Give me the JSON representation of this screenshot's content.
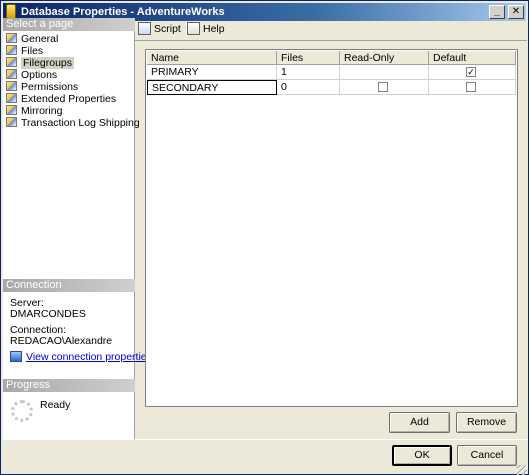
{
  "window": {
    "title": "Database Properties - AdventureWorks"
  },
  "left_pane": {
    "select_page_header": "Select a page",
    "pages": [
      {
        "label": "General",
        "selected": false
      },
      {
        "label": "Files",
        "selected": false
      },
      {
        "label": "Filegroups",
        "selected": true
      },
      {
        "label": "Options",
        "selected": false
      },
      {
        "label": "Permissions",
        "selected": false
      },
      {
        "label": "Extended Properties",
        "selected": false
      },
      {
        "label": "Mirroring",
        "selected": false
      },
      {
        "label": "Transaction Log Shipping",
        "selected": false
      }
    ],
    "connection_header": "Connection",
    "server_label": "Server:",
    "server_value": "DMARCONDES",
    "connection_label": "Connection:",
    "connection_value": "REDACAO\\Alexandre",
    "view_connection_link": "View connection properties",
    "progress_header": "Progress",
    "progress_status": "Ready"
  },
  "toolbar": {
    "script_label": "Script",
    "help_label": "Help"
  },
  "grid": {
    "columns": [
      "Name",
      "Files",
      "Read-Only",
      "Default"
    ],
    "rows": [
      {
        "name": "PRIMARY",
        "files": "1",
        "read_only": null,
        "default": true
      },
      {
        "name": "SECONDARY",
        "files": "0",
        "read_only": false,
        "default": false
      }
    ]
  },
  "buttons": {
    "add": "Add",
    "remove": "Remove",
    "ok": "OK",
    "cancel": "Cancel"
  }
}
